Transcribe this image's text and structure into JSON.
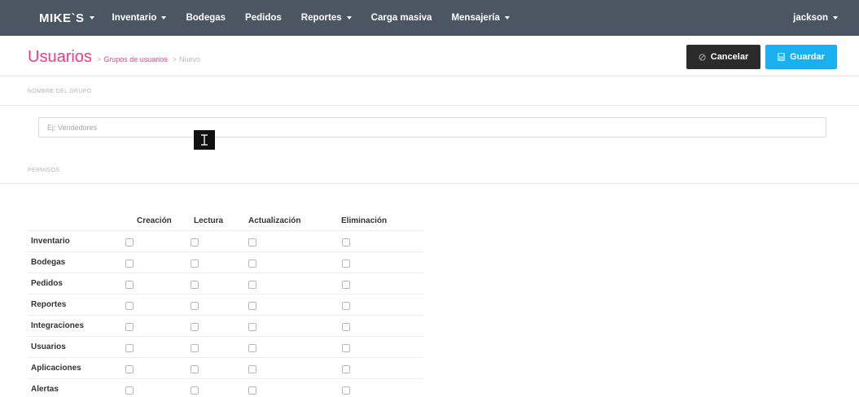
{
  "navbar": {
    "brand": "MIKE`S",
    "items": [
      {
        "label": "Inventario",
        "dropdown": true
      },
      {
        "label": "Bodegas",
        "dropdown": false
      },
      {
        "label": "Pedidos",
        "dropdown": false
      },
      {
        "label": "Reportes",
        "dropdown": true
      },
      {
        "label": "Carga masiva",
        "dropdown": false
      },
      {
        "label": "Mensajería",
        "dropdown": true
      }
    ],
    "user": "jackson"
  },
  "header": {
    "title": "Usuarios",
    "separator": ">",
    "breadcrumb_link": "Grupos de usuarios",
    "breadcrumb_current": "Nuevo",
    "cancel_label": "Cancelar",
    "save_label": "Guardar"
  },
  "form": {
    "group_name_label": "NOMBRE DEL GRUPO",
    "group_name_value": "",
    "group_name_placeholder": "Ej: Vendedores",
    "permissions_label": "PERMISOS"
  },
  "permissions": {
    "columns": [
      "Creación",
      "Lectura",
      "Actualización",
      "Eliminación"
    ],
    "rows": [
      {
        "label": "Inventario",
        "checked": [
          false,
          false,
          false,
          false
        ]
      },
      {
        "label": "Bodegas",
        "checked": [
          false,
          false,
          false,
          false
        ]
      },
      {
        "label": "Pedidos",
        "checked": [
          false,
          false,
          false,
          false
        ]
      },
      {
        "label": "Reportes",
        "checked": [
          false,
          false,
          false,
          false
        ]
      },
      {
        "label": "Integraciones",
        "checked": [
          false,
          false,
          false,
          false
        ]
      },
      {
        "label": "Usuarios",
        "checked": [
          false,
          false,
          false,
          false
        ]
      },
      {
        "label": "Aplicaciones",
        "checked": [
          false,
          false,
          false,
          false
        ]
      },
      {
        "label": "Alertas",
        "checked": [
          false,
          false,
          false,
          false
        ]
      }
    ]
  },
  "colors": {
    "navbar_bg": "#4a5661",
    "accent_pink": "#e83e8c",
    "cancel_bg": "#2b2b2b",
    "save_bg": "#1ab0ef"
  },
  "icons": {
    "cancel": "ban-icon",
    "save": "save-icon",
    "cursor": "text-cursor-icon"
  }
}
